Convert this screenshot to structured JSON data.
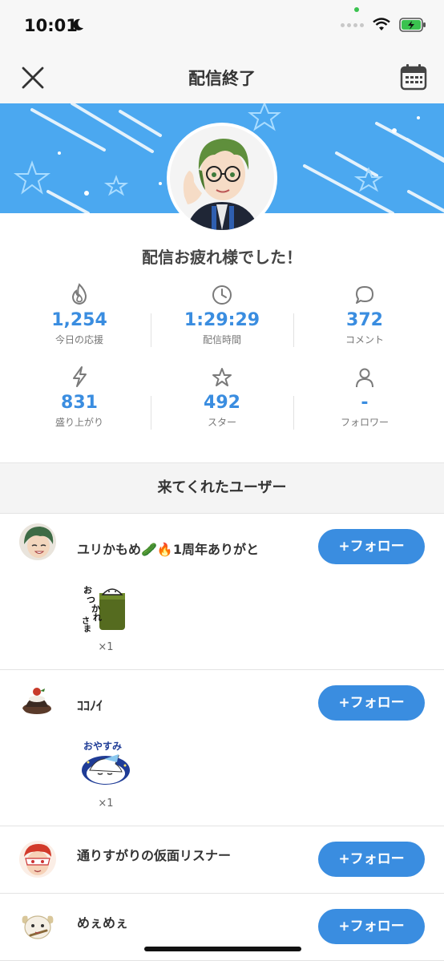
{
  "status": {
    "time": "10:01"
  },
  "nav": {
    "title": "配信終了"
  },
  "thanks_message": "配信お疲れ様でした！",
  "stats": [
    {
      "icon": "flame-icon",
      "value": "1,254",
      "label": "今日の応援"
    },
    {
      "icon": "clock-icon",
      "value": "1:29:29",
      "label": "配信時間"
    },
    {
      "icon": "comment-icon",
      "value": "372",
      "label": "コメント"
    },
    {
      "icon": "lightning-icon",
      "value": "831",
      "label": "盛り上がり"
    },
    {
      "icon": "star-icon",
      "value": "492",
      "label": "スター"
    },
    {
      "icon": "person-icon",
      "value": "-",
      "label": "フォロワー"
    }
  ],
  "section_title": "来てくれたユーザー",
  "users": [
    {
      "name": "ユリかもめ🥒🔥1周年ありがと",
      "follow_label": "+フォロー",
      "gift_text": "おつかれさま",
      "gift_count": "×1"
    },
    {
      "name": "ｺｺﾉｲ",
      "follow_label": "+フォロー",
      "gift_text": "おやすみ",
      "gift_count": "×1"
    },
    {
      "name": "通りすがりの仮面リスナー",
      "follow_label": "+フォロー"
    },
    {
      "name": "めぇめぇ",
      "follow_label": "+フォロー"
    }
  ],
  "colors": {
    "accent": "#3a8de0",
    "banner": "#4ba8f0"
  }
}
